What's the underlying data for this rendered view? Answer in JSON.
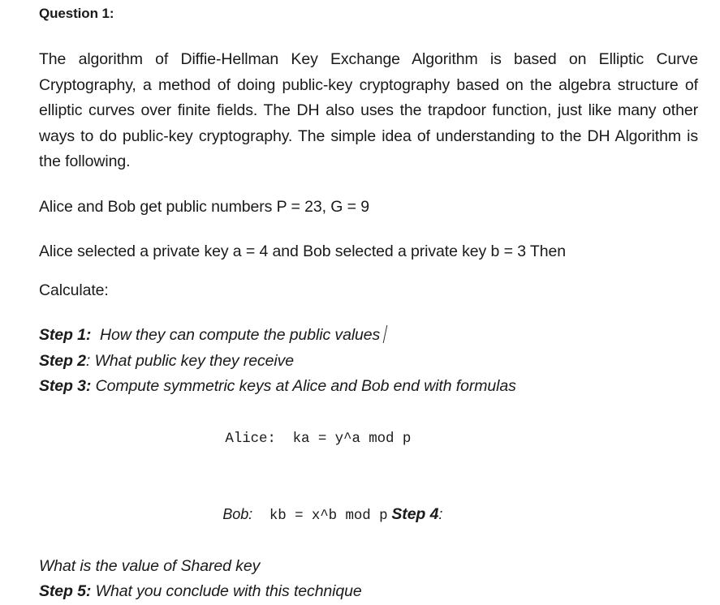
{
  "document": {
    "question_heading": "Question 1:",
    "paragraph": "The algorithm of Diffie-Hellman Key Exchange Algorithm is based on Elliptic Curve Cryptography, a method of doing public-key cryptography based on the algebra structure of elliptic curves over finite fields. The DH also uses the trapdoor function, just like many other ways to do public-key cryptography. The simple idea of understanding to the DH Algorithm is the following.",
    "public_numbers_line": "Alice and Bob get public numbers P = 23, G = 9",
    "private_keys_line": "Alice selected a private key a = 4 and Bob selected a private key b = 3 Then",
    "calculate_label": "Calculate:",
    "steps": [
      {
        "label": "Step 1:",
        "text": "How they can compute the public values",
        "trailing_caret": true
      },
      {
        "label": "Step 2",
        "separator": ":",
        "text": "What public key they receive",
        "trailing_caret": false
      },
      {
        "label": "Step 3:",
        "text": "Compute symmetric keys at Alice and Bob end with formulas",
        "trailing_caret": false
      }
    ],
    "formulas": {
      "alice_label": "Alice:",
      "alice_formula": "ka = y^a mod p",
      "bob_label": "Bob:",
      "bob_formula": "kb = x^b mod p",
      "inline_step_label": "Step 4",
      "inline_step_separator": ":"
    },
    "step4_text": "What is the value of Shared key",
    "step5": {
      "label": "Step 5:",
      "text": "What you conclude with this technique"
    }
  }
}
